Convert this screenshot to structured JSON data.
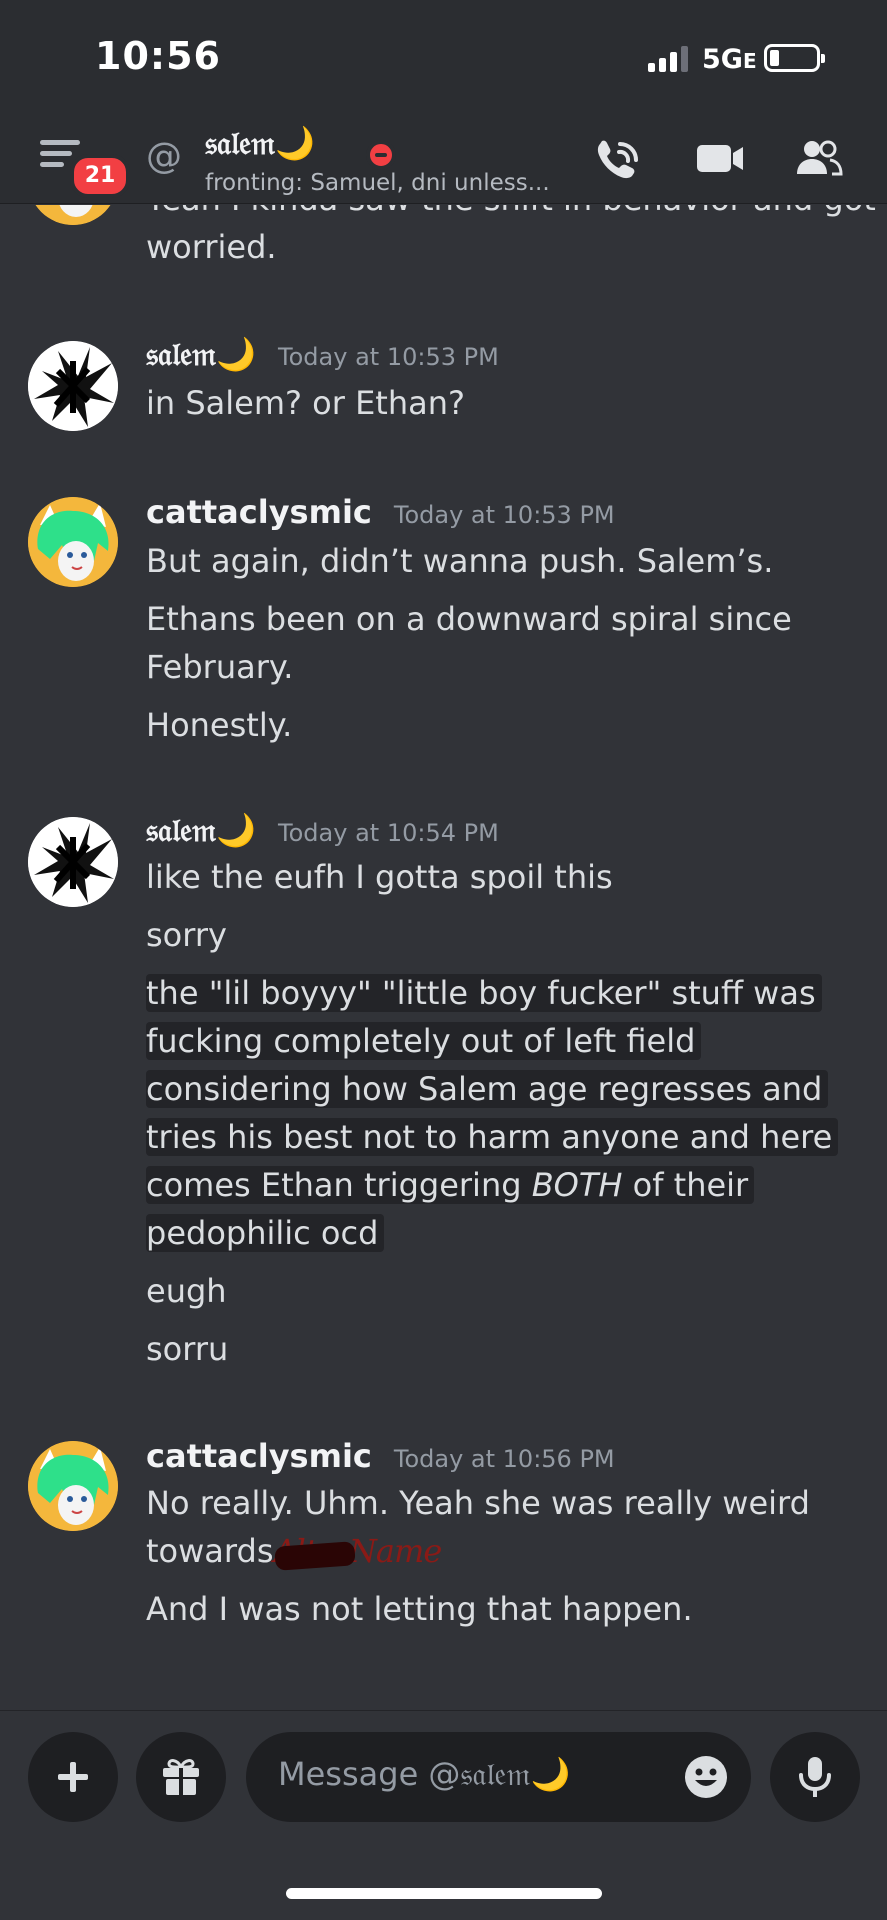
{
  "status_bar": {
    "time": "10:56",
    "network": "5G",
    "network_suffix": "E"
  },
  "header": {
    "unread_count": "21",
    "dm_name": "𝔰𝔞𝔩𝔢𝔪🌙",
    "dm_status": "fronting: Samuel, dni unless..."
  },
  "messages": {
    "partial": {
      "line1": "Yeah I kinda saw the shift in behavior and got",
      "line2": "worried."
    },
    "m1": {
      "author": "𝔰𝔞𝔩𝔢𝔪🌙",
      "timestamp": "Today at 10:53 PM",
      "line1": "in Salem? or Ethan?"
    },
    "m2": {
      "author": "cattaclysmic",
      "timestamp": "Today at 10:53 PM",
      "line1": "But again, didn’t wanna push. Salem’s.",
      "line2": "Ethans been on a downward spiral since",
      "line3": "February.",
      "line4": "Honestly."
    },
    "m3": {
      "author": "𝔰𝔞𝔩𝔢𝔪🌙",
      "timestamp": "Today at 10:54 PM",
      "line1": "like the eufh I gotta spoil this",
      "line2": "sorry",
      "spoiler1": "the \"lil boyyy\" \"little boy fucker\" stuff was",
      "spoiler2": "fucking completely out of left field",
      "spoiler3": "considering how Salem age regresses and",
      "spoiler4": "tries his best not to harm anyone and here",
      "spoiler5_pre": "comes Ethan triggering ",
      "spoiler5_em": "BOTH",
      "spoiler5_post": " of their",
      "spoiler6": "pedophilic ocd",
      "line3": "eugh",
      "line4": "sorru"
    },
    "m4": {
      "author": "cattaclysmic",
      "timestamp": "Today at 10:56 PM",
      "line1": "No really. Uhm. Yeah she was really weird",
      "line2": "towards",
      "redacted": "AlterName",
      "line3": "And I was not letting that happen."
    }
  },
  "composer": {
    "placeholder": "Message @𝔰𝔞𝔩𝔢𝔪🌙"
  },
  "icons": [
    "menu-icon",
    "at-icon",
    "call-icon",
    "video-icon",
    "members-icon",
    "plus-icon",
    "gift-icon",
    "emoji-icon",
    "mic-icon"
  ],
  "colors": {
    "background": "#313338",
    "header": "#2b2d31",
    "badge": "#f23f43",
    "cat_avatar_bg": "#f4b73c",
    "cat_hair": "#2ee08a"
  }
}
